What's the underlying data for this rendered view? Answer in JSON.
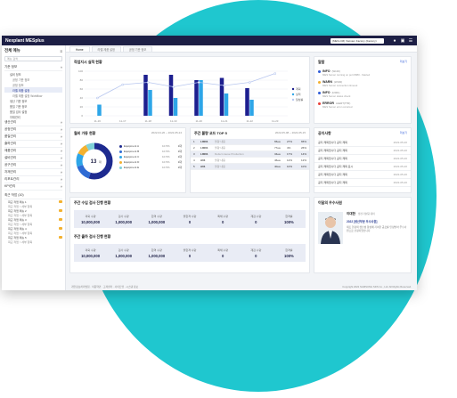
{
  "topbar": {
    "brand": "Nexplant MESplus",
    "site_select": "(MES-CM) Vietnam Factory (Factory)",
    "icons": [
      "user-icon",
      "window-icon",
      "menu-icon"
    ]
  },
  "sidebar": {
    "title": "전체 메뉴",
    "search_placeholder": "메뉴 검색",
    "groups": [
      {
        "label": "기준 정보",
        "open": true
      },
      {
        "label": "설비 정보",
        "open": true,
        "level": 1
      },
      {
        "label": "공정 기준 정보",
        "level": 2
      },
      {
        "label": "공정 정보",
        "level": 2
      },
      {
        "label": "라벨 제품 설정",
        "level": 2,
        "active": true
      },
      {
        "label": "라벨 제품 설정 Workflow",
        "level": 2
      },
      {
        "label": "생산 기준 정보",
        "level": 1
      },
      {
        "label": "품질 기준 정보",
        "level": 1
      },
      {
        "label": "품질 검사 설정",
        "level": 1
      },
      {
        "label": "자재관리",
        "level": 1
      },
      {
        "label": "생산관리"
      },
      {
        "label": "공정관리"
      },
      {
        "label": "품질관리"
      },
      {
        "label": "출하관리"
      },
      {
        "label": "제품관리"
      },
      {
        "label": "설비관리"
      },
      {
        "label": "공구관리"
      },
      {
        "label": "자재관리"
      },
      {
        "label": "리포트관리"
      },
      {
        "label": "KPI관리"
      }
    ],
    "recent_title": "최근 작업 (10)",
    "recent": [
      {
        "label": "최근 작업 메뉴 1",
        "sub": "최근 작업 > 세부 항목"
      },
      {
        "label": "최근 작업 메뉴 2",
        "sub": "최근 작업 > 세부 항목"
      },
      {
        "label": "최근 작업 메뉴 3",
        "sub": "최근 작업 > 세부 항목"
      },
      {
        "label": "최근 작업 메뉴 4",
        "sub": "최근 작업 > 세부 항목"
      },
      {
        "label": "최근 작업 메뉴 5",
        "sub": "최근 작업 > 세부 항목"
      }
    ]
  },
  "tabs": [
    "Home",
    "라벨 제품 설정",
    "공정 기준 정보"
  ],
  "chart_card": {
    "title": "작업지시 실적 현황"
  },
  "chart_data": {
    "type": "bar",
    "categories": [
      "11-16",
      "11-17",
      "11-18",
      "11-19",
      "11-20",
      "11-21",
      "11-22",
      "11-23"
    ],
    "series": [
      {
        "name": "계획",
        "color": "#1d1f8f",
        "values": [
          0,
          0,
          92,
          92,
          80,
          85,
          62,
          0
        ]
      },
      {
        "name": "실적",
        "color": "#2ea6e8",
        "values": [
          25,
          0,
          58,
          40,
          80,
          50,
          36,
          0
        ]
      },
      {
        "name": "달성률",
        "type": "line",
        "color": "#b8c7ef",
        "values": [
          40,
          70,
          75,
          65,
          75,
          68,
          75,
          95
        ]
      }
    ],
    "ylim": [
      0,
      100
    ],
    "yticks": [
      0,
      20,
      40,
      60,
      80,
      100
    ],
    "legend": "right"
  },
  "donut_card": {
    "title": "월비 가동 현황",
    "date": "2022-04-20 ~ 2022-05-24",
    "center": "13",
    "center_unit": "대",
    "items": [
      {
        "name": "Equipment A",
        "color": "#1d2a8f",
        "a": "10.5%",
        "b": "1대"
      },
      {
        "name": "Equipment B",
        "color": "#2f6bd4",
        "a": "10.5%",
        "b": "1대"
      },
      {
        "name": "Equipment C",
        "color": "#2ea6e8",
        "a": "10.5%",
        "b": "1대"
      },
      {
        "name": "Equipment D",
        "color": "#f3b12f",
        "a": "10.5%",
        "b": "1대"
      },
      {
        "name": "Equipment E",
        "color": "#7fd1d8",
        "a": "10.5%",
        "b": "1대"
      }
    ]
  },
  "donut_chart": {
    "values": [
      55,
      15,
      12,
      10,
      8
    ]
  },
  "top5_card": {
    "title": "주간 불량 코드 TOP 5",
    "date": "2022-05-08 ~ 2022-05-15",
    "rows": [
      {
        "no": "1",
        "code": "L0001",
        "desc": "불량 내용",
        "a": "65ea",
        "b": "27%",
        "c": "65%"
      },
      {
        "no": "2",
        "code": "L0001",
        "desc": "불량 내용",
        "a": "77ea",
        "b": "4%",
        "c": "26%"
      },
      {
        "no": "3",
        "code": "L0001",
        "desc": "Defect cause Production",
        "a": "34ea",
        "b": "17%",
        "c": "14%"
      },
      {
        "no": "4",
        "code": "A01",
        "desc": "불량 내용",
        "a": "46ea",
        "b": "12%",
        "c": "12%"
      },
      {
        "no": "5",
        "code": "A01",
        "desc": "불량 내용",
        "a": "40ea",
        "b": "10%",
        "c": "10%"
      }
    ]
  },
  "weekly_in": {
    "title": "주간 수입 검사 진행 현황",
    "stats": [
      {
        "label": "의뢰 수량",
        "value": "10,000,000"
      },
      {
        "label": "검사 수량",
        "value": "1,000,000"
      },
      {
        "label": "합격 수량",
        "value": "1,000,000"
      },
      {
        "label": "불합격 수량",
        "value": "0"
      },
      {
        "label": "특채 수량",
        "value": "0"
      },
      {
        "label": "재검 수량",
        "value": "0"
      },
      {
        "label": "합격률",
        "value": "100%"
      }
    ]
  },
  "weekly_out": {
    "title": "주간 출하 검사 진행 현황",
    "stats": [
      {
        "label": "의뢰 수량",
        "value": "10,000,000"
      },
      {
        "label": "검사 수량",
        "value": "1,000,000"
      },
      {
        "label": "합격 수량",
        "value": "1,000,000"
      },
      {
        "label": "불합격 수량",
        "value": "0"
      },
      {
        "label": "특채 수량",
        "value": "0"
      },
      {
        "label": "재검 수량",
        "value": "0"
      },
      {
        "label": "합격률",
        "value": "100%"
      }
    ]
  },
  "alarm_card": {
    "title": "알람",
    "link": "더보기",
    "items": [
      {
        "level": "INFO",
        "code": "(W100)",
        "color": "#2f5cd8",
        "msg": "MES Server running on port 8080 - Started"
      },
      {
        "level": "WARN",
        "code": "(W100)",
        "color": "#f3b12f",
        "msg": "MES Server connection timeout"
      },
      {
        "level": "INFO",
        "code": "(I2001)",
        "color": "#2f5cd8",
        "msg": "MES Server status check"
      },
      {
        "level": "ERROR",
        "code": "ALERT(TTR)",
        "color": "#e8403a",
        "msg": "MES Server error occurred"
      }
    ]
  },
  "notice_card": {
    "title": "공지사항",
    "link": "더보기",
    "items": [
      {
        "text": "공지 제목입니다 공지 제목",
        "date": "2022-05-20"
      },
      {
        "text": "공지 제목입니다 공지 제목",
        "date": "2022-05-20"
      },
      {
        "text": "공지 제목입니다 공지 제목",
        "date": "2022-05-20"
      },
      {
        "text": "공지 제목입니다 공지 제목 표시",
        "date": "2022-05-20"
      },
      {
        "text": "공지 제목입니다 공지 제목",
        "date": "2022-05-20"
      },
      {
        "text": "공지 제목입니다 공지 제목",
        "date": "2022-05-20"
      }
    ]
  },
  "employee_card": {
    "title": "이달의 우수사원",
    "name": "이대한",
    "dept": "생산기술팀 대리",
    "headline": "2022 [생산부문 우수사원]",
    "desc": "제조 현장의 생산성 향상에 기여한 공로를 인정받아 우수사원으로 선정되었습니다."
  },
  "footer": {
    "links": "개인정보처리방침 · 이용약관 · 고객센터 · 사이트맵 · 시스템 정보",
    "copyright": "Copyright 2022 SAMSUNG SDS Co., Ltd. All Rights Reserved."
  }
}
